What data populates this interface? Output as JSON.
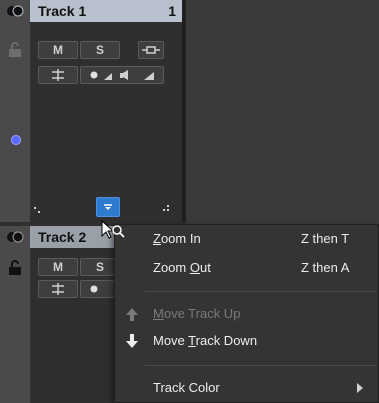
{
  "track1": {
    "name": "Track 1",
    "number": "1",
    "mute_label": "M",
    "solo_label": "S"
  },
  "track2": {
    "name": "Track 2",
    "mute_label": "M",
    "solo_label": "S"
  },
  "context_menu": {
    "items": [
      {
        "pre": "",
        "mnemonic": "Z",
        "post": "oom In",
        "shortcut": "Z then T",
        "enabled": true
      },
      {
        "pre": "Zoom ",
        "mnemonic": "O",
        "post": "ut",
        "shortcut": "Z then A",
        "enabled": true
      },
      {
        "pre": "",
        "mnemonic": "M",
        "post": "ove Track Up",
        "shortcut": "",
        "enabled": false,
        "icon": "arrow-up-icon"
      },
      {
        "pre": "Move ",
        "mnemonic": "T",
        "post": "rack Down",
        "shortcut": "",
        "enabled": true,
        "icon": "arrow-down-icon"
      },
      {
        "label": "Track Color",
        "shortcut": "",
        "enabled": true,
        "has_submenu": true
      }
    ]
  },
  "colors": {
    "track_active_header": "#b7c0cc",
    "track_header": "#9aa0a8",
    "accent_blue": "#2e7bd0",
    "indicator_dot": "#5b68ff"
  }
}
